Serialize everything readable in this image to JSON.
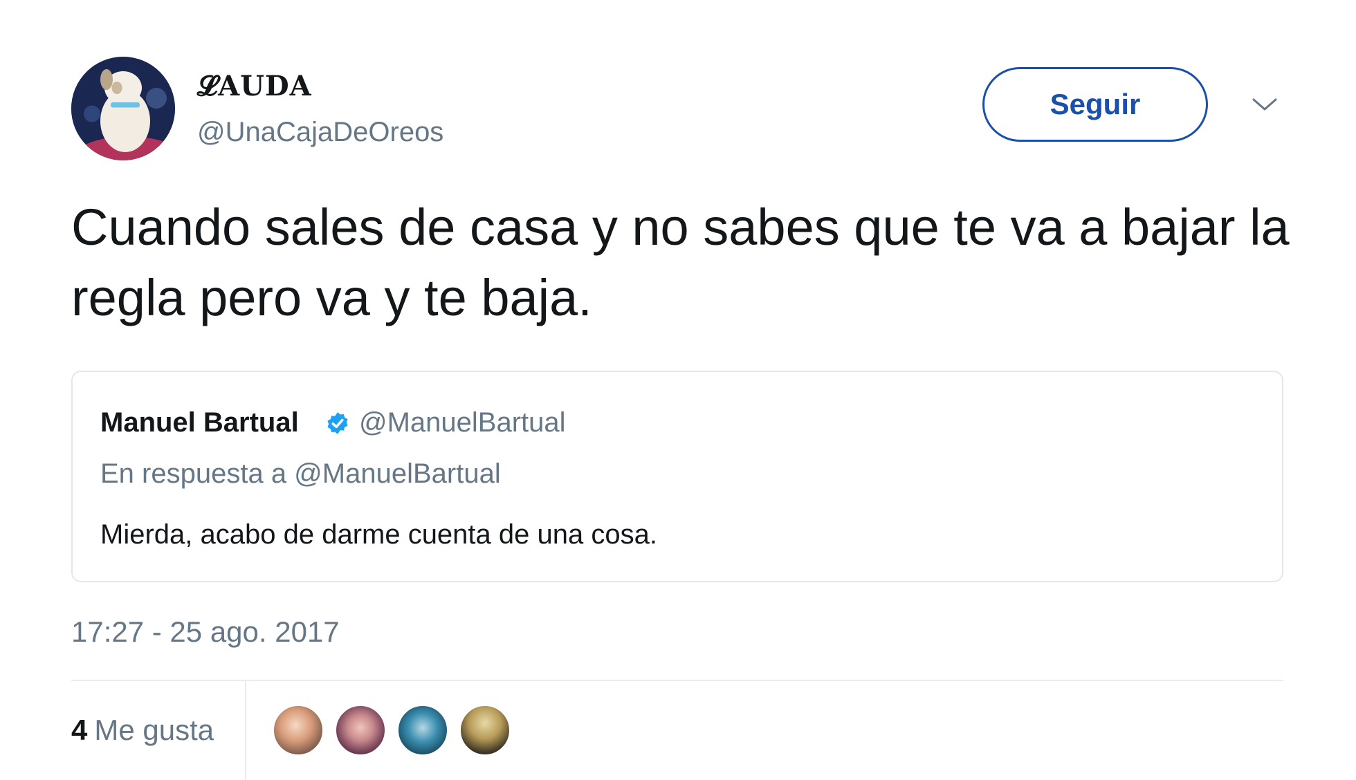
{
  "author": {
    "display_name": "𝓛AUDA",
    "handle": "@UnaCajaDeOreos"
  },
  "actions": {
    "follow_label": "Seguir"
  },
  "tweet": {
    "text": "Cuando sales de casa y no sabes que te va a bajar la regla pero va y te baja."
  },
  "quoted_tweet": {
    "name": "Manuel Bartual",
    "handle": "@ManuelBartual",
    "reply_to": "En respuesta a @ManuelBartual",
    "text": "Mierda, acabo de darme cuenta de una cosa."
  },
  "meta": {
    "timestamp": "17:27 - 25 ago. 2017"
  },
  "engagement": {
    "likes_count": "4",
    "likes_label": "Me gusta"
  },
  "colors": {
    "accent": "#1b4fa8",
    "verified": "#1da1f2",
    "secondary_text": "#657786",
    "border": "#e1e8ed"
  },
  "icons": {
    "caret": "chevron-down-icon",
    "verified": "verified-badge-icon"
  }
}
